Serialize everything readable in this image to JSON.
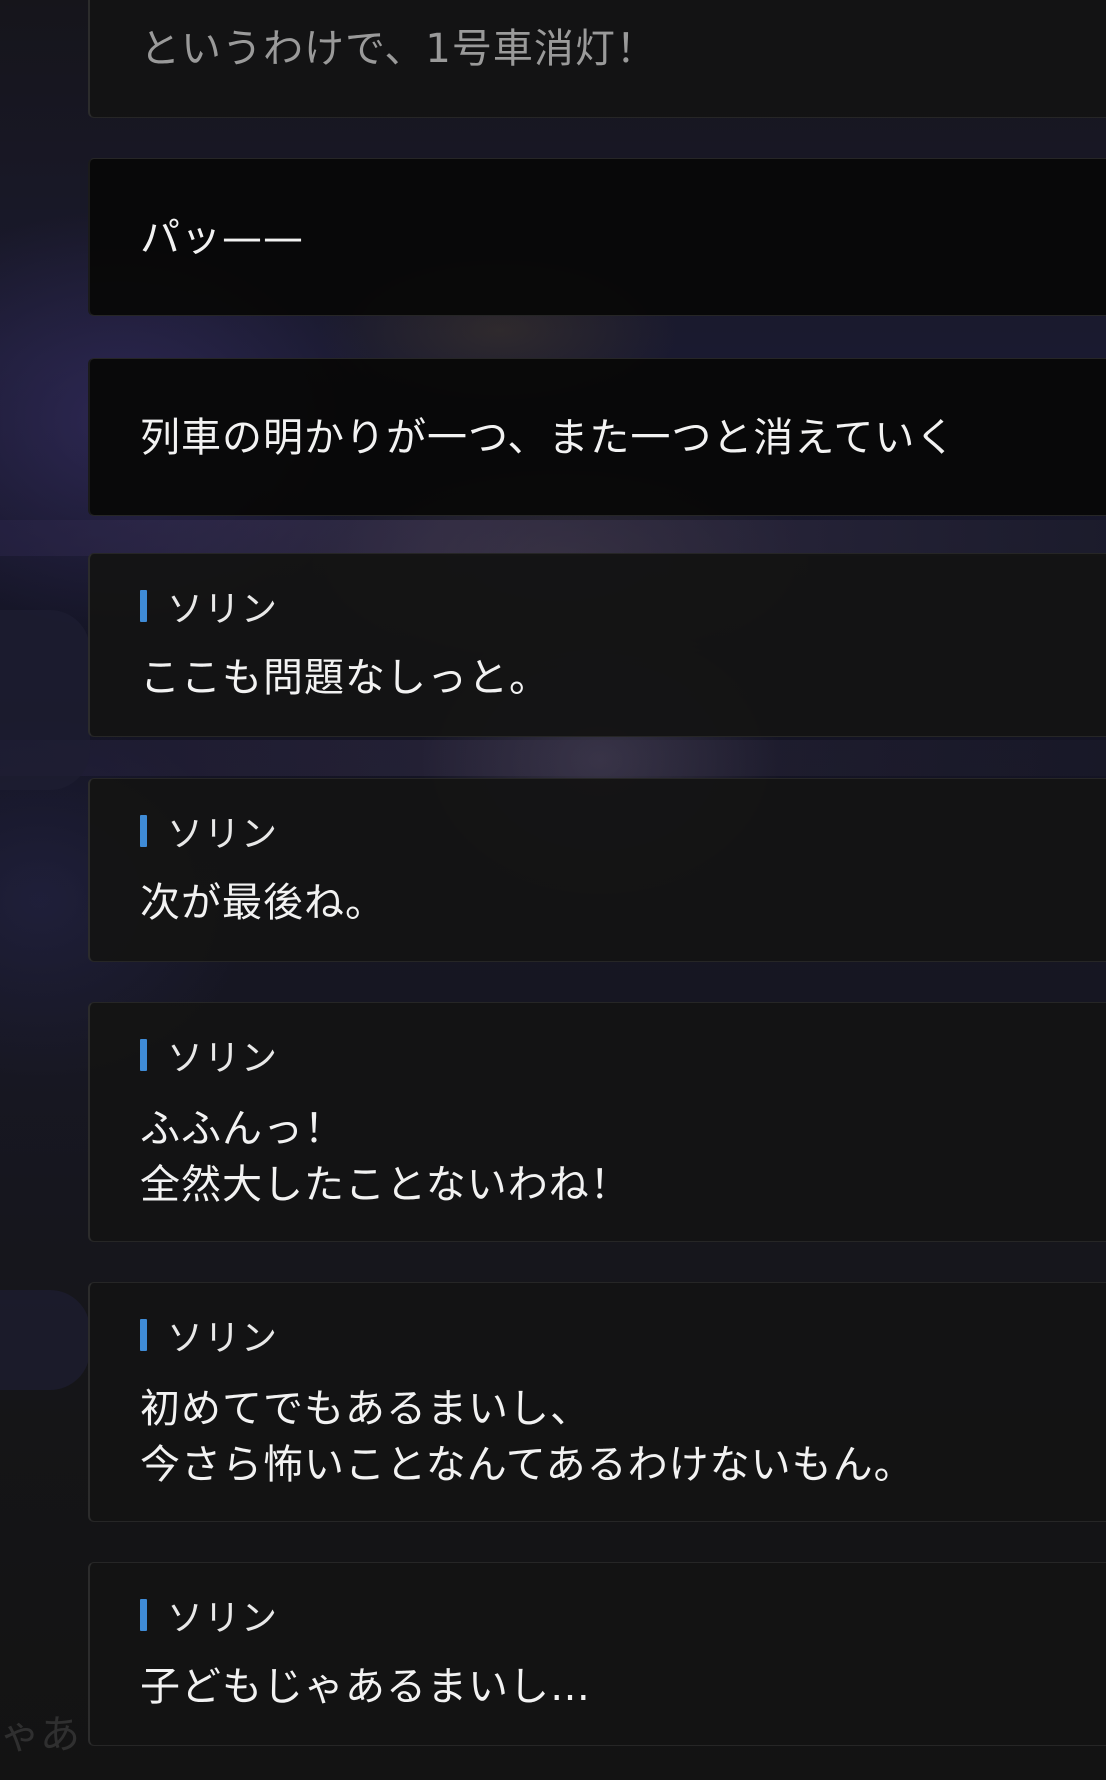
{
  "messages": [
    {
      "type": "narration",
      "text": "というわけで、1号車消灯！"
    },
    {
      "type": "narration",
      "text": "パッ——"
    },
    {
      "type": "narration",
      "text": "列車の明かりが一つ、また一つと消えていく"
    },
    {
      "type": "dialogue",
      "speaker": "ソリン",
      "text": "ここも問題なしっと。"
    },
    {
      "type": "dialogue",
      "speaker": "ソリン",
      "text": "次が最後ね。"
    },
    {
      "type": "dialogue",
      "speaker": "ソリン",
      "text": "ふふんっ！\n全然大したことないわね！"
    },
    {
      "type": "dialogue",
      "speaker": "ソリン",
      "text": "初めてでもあるまいし、\n今さら怖いことなんてあるわけないもん。"
    },
    {
      "type": "dialogue",
      "speaker": "ソリン",
      "text": "子どもじゃあるまいし…"
    }
  ],
  "background_partial_text": "ゃあ",
  "colors": {
    "speaker_accent": "#3f8bd6",
    "card_background": "#141414",
    "narration_background": "#080808",
    "text": "#f2f2f2"
  }
}
